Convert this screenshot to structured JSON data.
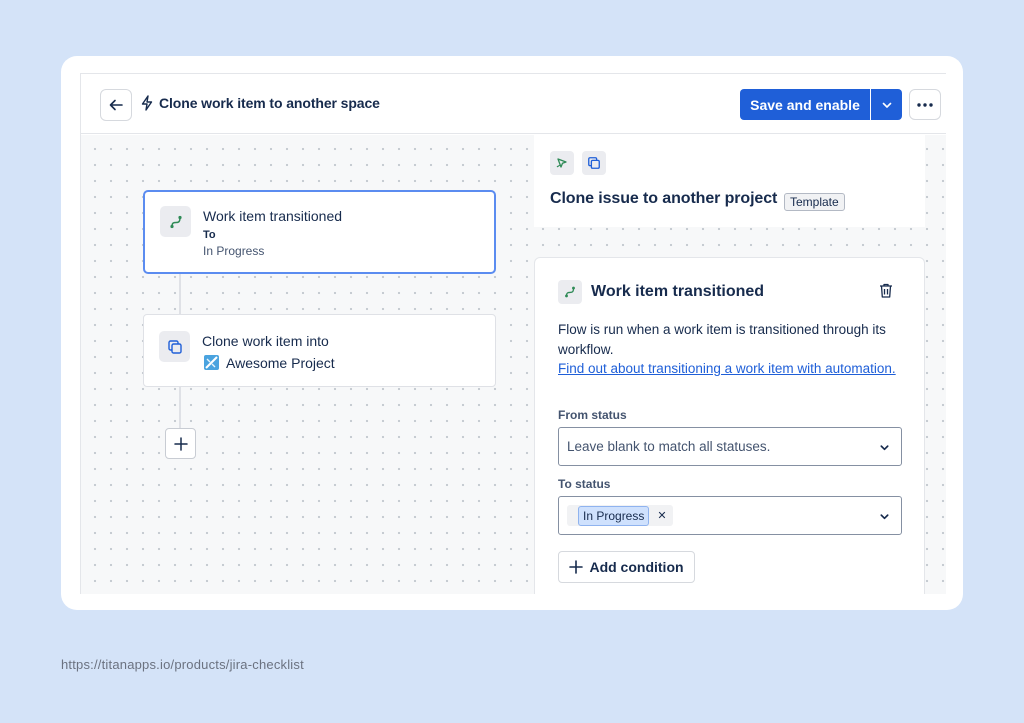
{
  "header": {
    "title": "Clone work item to another space",
    "save_label": "Save and enable"
  },
  "canvas": {
    "trigger": {
      "title": "Work item transitioned",
      "to_label": "To",
      "status": "In Progress"
    },
    "action": {
      "title": "Clone work item into",
      "project": "Awesome Project"
    }
  },
  "panel": {
    "title": "Clone issue to another project",
    "tag": "Template",
    "card_title": "Work item transitioned",
    "description": "Flow is run when a work item is transitioned through its workflow.",
    "link_text": "Find out about transitioning a work item with automation.",
    "from_label": "From status",
    "from_placeholder": "Leave blank to match all statuses.",
    "to_label": "To status",
    "to_value": "In Progress",
    "add_condition_label": "Add condition"
  },
  "footer": {
    "url": "https://titanapps.io/products/jira-checklist"
  },
  "colors": {
    "primary": "#1f5fd8",
    "selected_border": "#5b8cf0",
    "background": "#d4e3f8",
    "trigger_icon": "#2e8a56"
  }
}
